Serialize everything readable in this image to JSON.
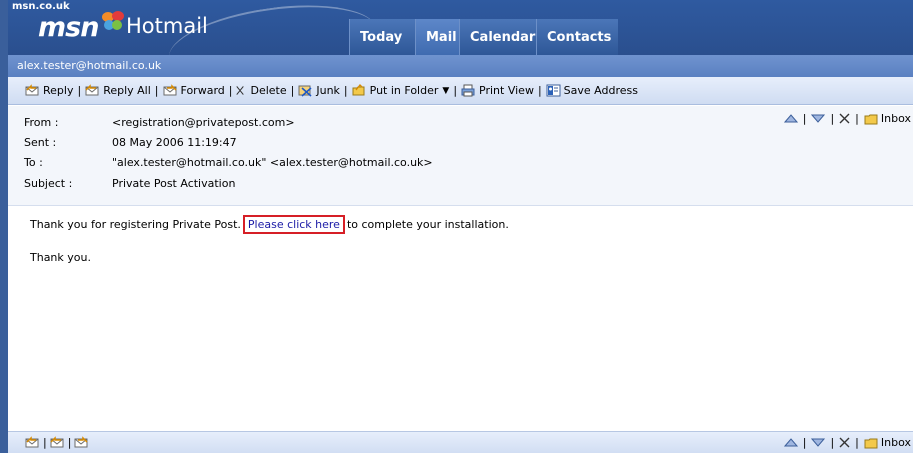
{
  "header": {
    "site": "msn.co.uk",
    "logo": "msn",
    "product": "Hotmail",
    "tabs": [
      {
        "label": "Today",
        "active": false
      },
      {
        "label": "Mail",
        "active": true
      },
      {
        "label": "Calendar",
        "active": false
      },
      {
        "label": "Contacts",
        "active": false
      }
    ]
  },
  "account": "alex.tester@hotmail.co.uk",
  "toolbar": {
    "reply": "Reply",
    "reply_all": "Reply All",
    "forward": "Forward",
    "delete": "Delete",
    "junk": "Junk",
    "put_in_folder": "Put in Folder",
    "print_view": "Print View",
    "save_address": "Save Address"
  },
  "message": {
    "from_label": "From :",
    "from": "<registration@privatepost.com>",
    "sent_label": "Sent :",
    "sent": "08 May 2006 11:19:47",
    "to_label": "To :",
    "to": "\"alex.tester@hotmail.co.uk\" <alex.tester@hotmail.co.uk>",
    "subject_label": "Subject :",
    "subject": "Private Post Activation",
    "body_before": "Thank you for registering Private Post.",
    "link_text": "Please click here",
    "body_after": "to complete your installation.",
    "closing": "Thank you."
  },
  "nav": {
    "folder": "Inbox"
  },
  "colors": {
    "header_blue": "#2f5aa0",
    "account_bar": "#6f93cf",
    "highlight_box": "#d61f26",
    "link": "#1a1aa6"
  }
}
